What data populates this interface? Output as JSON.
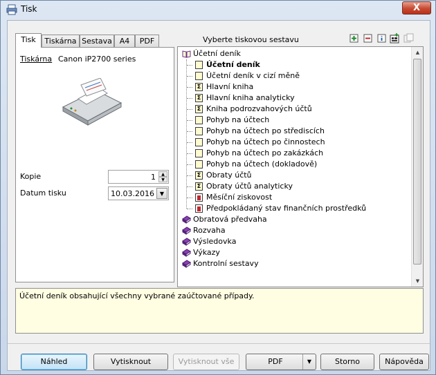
{
  "window": {
    "title": "Tisk",
    "close_label": "X"
  },
  "tabs": [
    {
      "label": "Tisk"
    },
    {
      "label": "Tiskárna"
    },
    {
      "label": "Sestava"
    },
    {
      "label": "A4"
    },
    {
      "label": "PDF"
    }
  ],
  "header_label": "Vyberte tiskovou sestavu",
  "toolbar": [
    {
      "icon": "expand-icon",
      "symbol": "+"
    },
    {
      "icon": "collapse-icon",
      "symbol": "−"
    },
    {
      "icon": "info-icon",
      "symbol": "i"
    },
    {
      "icon": "add-report-icon",
      "symbol": "▦"
    },
    {
      "icon": "copy-report-icon",
      "symbol": "▤"
    }
  ],
  "printer": {
    "link_label": "Tiskárna",
    "name": "Canon iP2700 series"
  },
  "copies": {
    "label": "Kopie",
    "value": "1"
  },
  "print_date": {
    "label": "Datum tisku",
    "value": "10.03.2016"
  },
  "tree": [
    {
      "label": "Účetní deník",
      "icon": "book-open",
      "level": 0
    },
    {
      "label": "Účetní deník",
      "icon": "doc",
      "level": 1,
      "bold": true
    },
    {
      "label": "Účetní deník v cizí měně",
      "icon": "doc",
      "level": 1
    },
    {
      "label": "Hlavní kniha",
      "icon": "sigma",
      "level": 1
    },
    {
      "label": "Hlavní kniha analyticky",
      "icon": "sigma",
      "level": 1
    },
    {
      "label": "Kniha podrozvahových účtů",
      "icon": "sigma",
      "level": 1
    },
    {
      "label": "Pohyb na účtech",
      "icon": "doc",
      "level": 1
    },
    {
      "label": "Pohyb na účtech po střediscích",
      "icon": "doc",
      "level": 1
    },
    {
      "label": "Pohyb na účtech po činnostech",
      "icon": "doc",
      "level": 1
    },
    {
      "label": "Pohyb na účtech po zakázkách",
      "icon": "doc",
      "level": 1
    },
    {
      "label": "Pohyb na účtech (dokladově)",
      "icon": "doc",
      "level": 1
    },
    {
      "label": "Obraty účtů",
      "icon": "sigma",
      "level": 1
    },
    {
      "label": "Obraty účtů analyticky",
      "icon": "sigma",
      "level": 1
    },
    {
      "label": "Měsíční ziskovost",
      "icon": "chart",
      "level": 1
    },
    {
      "label": "Předpokládaný stav finančních prostředků",
      "icon": "chart",
      "level": 1
    },
    {
      "label": "Obratová předvaha",
      "icon": "book-closed",
      "level": 0
    },
    {
      "label": "Rozvaha",
      "icon": "book-closed",
      "level": 0
    },
    {
      "label": "Výsledovka",
      "icon": "book-closed",
      "level": 0
    },
    {
      "label": "Výkazy",
      "icon": "book-closed",
      "level": 0
    },
    {
      "label": "Kontrolní sestavy",
      "icon": "book-closed",
      "level": 0
    }
  ],
  "description": "Účetní deník obsahující všechny vybrané zaúčtované případy.",
  "buttons": {
    "preview": "Náhled",
    "print": "Vytisknout",
    "print_all": "Vytisknout vše",
    "pdf": "PDF",
    "cancel": "Storno",
    "help": "Nápověda"
  },
  "colors": {
    "book_purple": "#6a2d8f",
    "chart_red": "#c0282d",
    "desc_bg": "#fffde2"
  }
}
